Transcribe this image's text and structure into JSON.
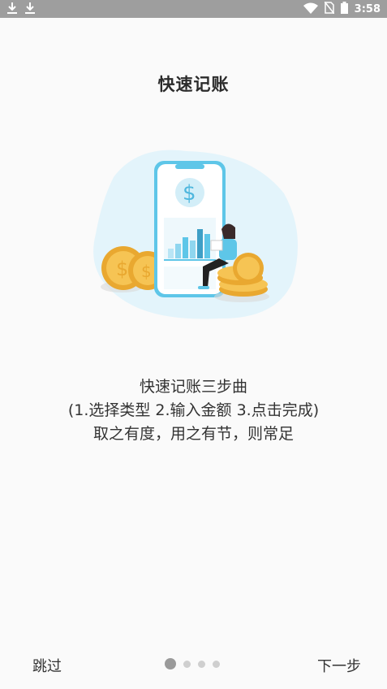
{
  "status_bar": {
    "time": "3:58",
    "icons": [
      "download-icon",
      "download-icon",
      "wifi-icon",
      "no-sim-icon",
      "battery-icon"
    ]
  },
  "page": {
    "title": "快速记账",
    "description_lines": [
      "快速记账三步曲",
      "(1.选择类型 2.输入金额 3.点击完成)",
      "取之有度，用之有节，则常足"
    ]
  },
  "navigation": {
    "skip_label": "跳过",
    "next_label": "下一步",
    "page_count": 4,
    "current_page": 1
  },
  "colors": {
    "accent_blue": "#5ec6e8",
    "coin_gold": "#f2b640",
    "blob_bg": "#e3f4fb",
    "status_bar": "#9e9e9e"
  }
}
